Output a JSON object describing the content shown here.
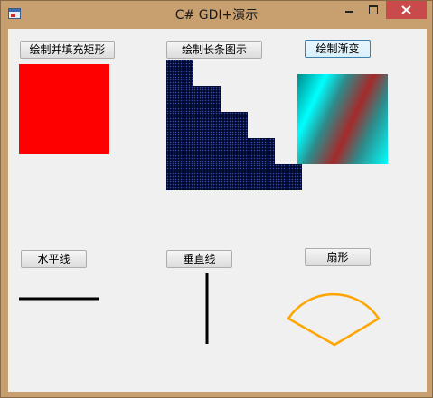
{
  "window": {
    "title": "C# GDI+演示"
  },
  "buttons": {
    "fill_rect": "绘制并填充矩形",
    "bar_chart": "绘制长条图示",
    "gradient": "绘制渐变",
    "hline": "水平线",
    "vline": "垂直线",
    "sector": "扇形"
  },
  "bar_chart": {
    "steps": 5,
    "values": [
      1,
      2,
      3,
      4,
      5
    ],
    "fill_color": "#000a2e",
    "dot_color": "#3a4ab0"
  },
  "colors": {
    "rect_fill": "#ff0000",
    "gradient_stops": [
      "#00ffff",
      "#a52a2a"
    ],
    "line_color": "#000000",
    "sector_color": "#ffa500",
    "close_button": "#c94a4a"
  },
  "icons": [
    "app-icon",
    "minimize-icon",
    "maximize-icon",
    "close-icon"
  ]
}
